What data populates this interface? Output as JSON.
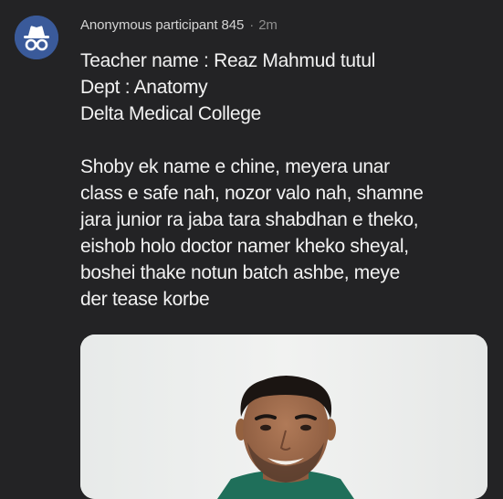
{
  "post": {
    "author": "Anonymous participant 845",
    "separator": "·",
    "time": "2m",
    "avatar_icon": "incognito-icon",
    "avatar_color": "#3a5a9a",
    "details": [
      "Teacher name : Reaz Mahmud tutul",
      "Dept : Anatomy",
      "Delta Medical College"
    ],
    "message_lines": [
      "Shoby ek name e chine, meyera unar",
      "class e safe nah, nozor valo nah, shamne",
      "jara junior ra jaba tara shabdhan e theko,",
      "eishob holo doctor namer kheko sheyal,",
      "boshei thake notun batch ashbe, meye",
      "der tease korbe"
    ],
    "photo_description_icon": "person-photo"
  }
}
